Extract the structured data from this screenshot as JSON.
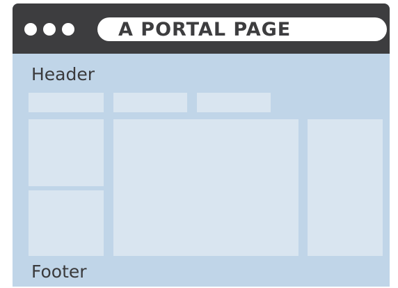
{
  "browser": {
    "address_bar_text": "A PORTAL PAGE",
    "window_dots": [
      "dot",
      "dot",
      "dot"
    ]
  },
  "layout_labels": {
    "header": "Header",
    "footer": "Footer"
  },
  "colors": {
    "title_bar": "#3d3d3f",
    "page_background": "#c0d5e8",
    "block_fill": "#d9e5f0",
    "text": "#3a3a3c"
  }
}
